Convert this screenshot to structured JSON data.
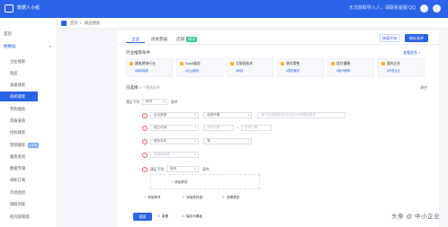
{
  "app": {
    "title": "数据人小纸",
    "topbar_notice": "无法获取导入人，请联系客服 QQ"
  },
  "sidebar": {
    "home": "首页",
    "group": "圈数据",
    "items": [
      {
        "label": "企业搜索"
      },
      {
        "label": "商品"
      },
      {
        "label": "高级搜索"
      },
      {
        "label": "商机搜索",
        "active": true
      },
      {
        "label": "专利搜索"
      },
      {
        "label": "资质查询"
      },
      {
        "label": "招标搜索"
      },
      {
        "label": "营销搜索",
        "tag": "NEW"
      },
      {
        "label": "融资查询"
      },
      {
        "label": "数据专辑"
      },
      {
        "label": "商机订阅"
      },
      {
        "label": "市场监控"
      },
      {
        "label": "调取列表"
      },
      {
        "label": "批内容管理"
      }
    ]
  },
  "breadcrumb": [
    "首页",
    "/",
    "商品搜索"
  ],
  "tabs": [
    {
      "label": "企业",
      "active": true
    },
    {
      "label": "找发票器"
    },
    {
      "label": "店铺",
      "badge": "NEW"
    }
  ],
  "actions": {
    "secondary": "快速开始",
    "primary": "保存条件"
  },
  "recommend": {
    "title": "行业推荐条件",
    "more": "查看更多 >",
    "tiles": [
      {
        "title": "建筑装饰行业",
        "sub": "#装修装修"
      },
      {
        "title": "SaaS服务",
        "sub": "#企业服务"
      },
      {
        "title": "互联网技术",
        "sub": "#科技"
      },
      {
        "title": "餐饮零售",
        "sub": "#零售餐饮"
      },
      {
        "title": "医疗健康",
        "sub": "#医疗器械"
      },
      {
        "title": "国内企业",
        "sub": "#外贸企业"
      }
    ]
  },
  "conditions": {
    "title": "已选择",
    "count_note": "5 个筛选条件",
    "reset": "清空",
    "match_label": "满足下列",
    "match_value": "所有",
    "match_suffix": "条件",
    "rows": [
      {
        "field": "企业类型",
        "op": "选择不限",
        "value": "请个技术值查询从已经公司和筛选条件"
      },
      {
        "field": "成立时间",
        "op": "开始日期",
        "value": "结束日期"
      },
      {
        "field": "联系手机",
        "op": "有"
      },
      {
        "field": "请选择条件"
      },
      {
        "field": "满足下列",
        "op": "所有",
        "suffix": "条件"
      }
    ],
    "nested_add": "添加条件",
    "add_condition": "添加条件",
    "add_group": "添加条件组",
    "advanced": "查看更多"
  },
  "footer": {
    "search": "搜索",
    "reset": "重置",
    "save": "保存为模板"
  },
  "watermark": "头条 @ 中小企业"
}
